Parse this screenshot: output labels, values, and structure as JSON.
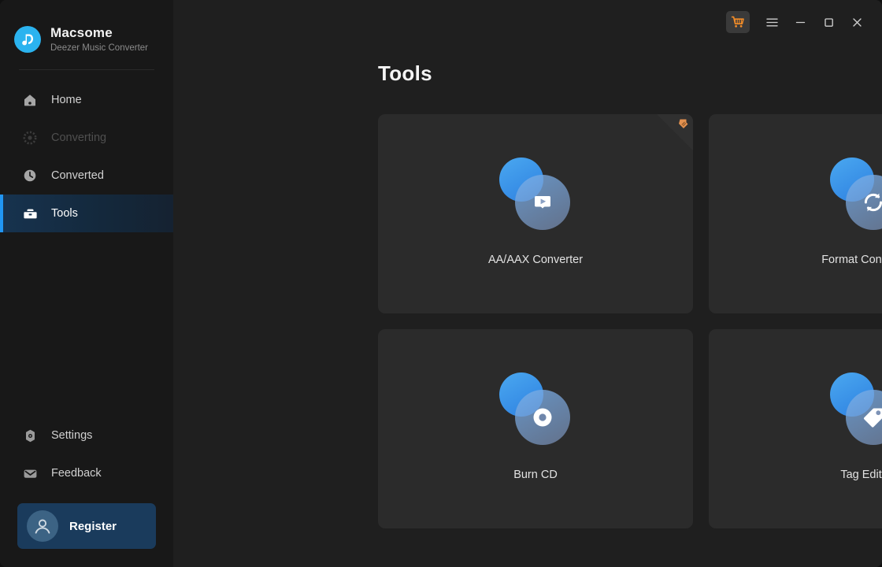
{
  "brand": {
    "name": "Macsome",
    "subtitle": "Deezer Music Converter",
    "logo_icon": "music-note-d-logo"
  },
  "sidebar": {
    "items": [
      {
        "label": "Home",
        "icon": "home-icon",
        "state": "normal"
      },
      {
        "label": "Converting",
        "icon": "convert-spinner-icon",
        "state": "disabled"
      },
      {
        "label": "Converted",
        "icon": "clock-icon",
        "state": "normal"
      },
      {
        "label": "Tools",
        "icon": "toolbox-icon",
        "state": "active"
      }
    ],
    "bottom_items": [
      {
        "label": "Settings",
        "icon": "gear-icon"
      },
      {
        "label": "Feedback",
        "icon": "envelope-icon"
      }
    ],
    "register": {
      "label": "Register",
      "icon": "user-avatar-icon"
    }
  },
  "titlebar": {
    "cart_icon": "shopping-cart-icon",
    "menu_icon": "hamburger-menu-icon",
    "minimize_icon": "minimize-icon",
    "maximize_icon": "maximize-icon",
    "close_icon": "close-icon"
  },
  "main": {
    "page_title": "Tools",
    "cards": [
      {
        "label": "AA/AAX Converter",
        "icon": "play-book-icon",
        "ribbon": true,
        "ribbon_icon": "new-feature-badge-icon"
      },
      {
        "label": "Format Converter",
        "icon": "refresh-arrows-icon",
        "ribbon": false
      },
      {
        "label": "Burn CD",
        "icon": "compact-disc-icon",
        "ribbon": false
      },
      {
        "label": "Tag Editor",
        "icon": "price-tag-icon",
        "ribbon": false
      }
    ]
  },
  "colors": {
    "accent_blue": "#2196f3",
    "logo_cyan": "#2bb3ef",
    "ribbon_orange": "#e2914f",
    "cart_orange": "#f28c28",
    "sidebar_bg": "#181818",
    "main_bg": "#1f1f1f",
    "card_bg": "#2b2b2b",
    "active_nav_bg": "#17334f",
    "register_bg": "#1a3b5c"
  }
}
